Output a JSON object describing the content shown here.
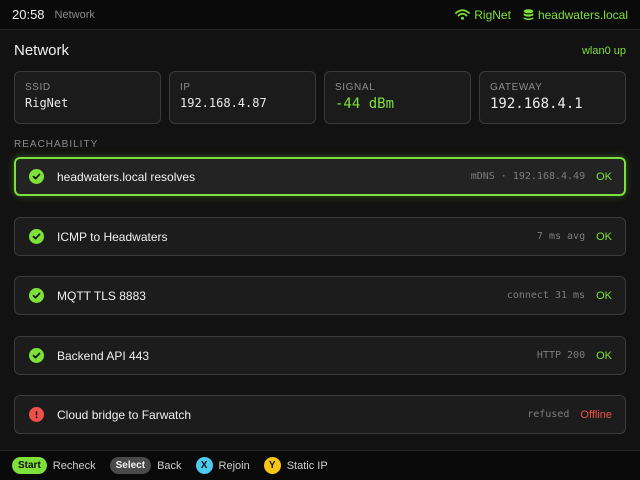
{
  "status_bar": {
    "time": "20:58",
    "breadcrumb": "Network",
    "wifi_name": "RigNet",
    "host": "headwaters.local"
  },
  "page": {
    "title": "Network",
    "interface_status": "wlan0 up"
  },
  "stats": [
    {
      "label": "SSID",
      "value": "RigNet"
    },
    {
      "label": "IP",
      "value": "192.168.4.87"
    },
    {
      "label": "SIGNAL",
      "value": "-44 dBm"
    },
    {
      "label": "GATEWAY",
      "value": "192.168.4.1"
    }
  ],
  "section_label": "REACHABILITY",
  "checks": [
    {
      "name": "headwaters.local resolves",
      "detail": "mDNS · 192.168.4.49",
      "result": "OK",
      "state": "ok"
    },
    {
      "name": "ICMP to Headwaters",
      "detail": "7 ms avg",
      "result": "OK",
      "state": "ok"
    },
    {
      "name": "MQTT TLS 8883",
      "detail": "connect 31 ms",
      "result": "OK",
      "state": "ok"
    },
    {
      "name": "Backend API 443",
      "detail": "HTTP 200",
      "result": "OK",
      "state": "ok"
    },
    {
      "name": "Cloud bridge to Farwatch",
      "detail": "refused",
      "result": "Offline",
      "state": "error"
    }
  ],
  "hints": [
    {
      "button": "Start",
      "action": "Recheck"
    },
    {
      "button": "Select",
      "action": "Back"
    },
    {
      "button": "X",
      "action": "Rejoin"
    },
    {
      "button": "Y",
      "action": "Static IP"
    }
  ],
  "colors": {
    "accent": "#7ee03a",
    "error": "#f0504a",
    "button_x": "#4ec9f0",
    "button_y": "#f5c518"
  }
}
